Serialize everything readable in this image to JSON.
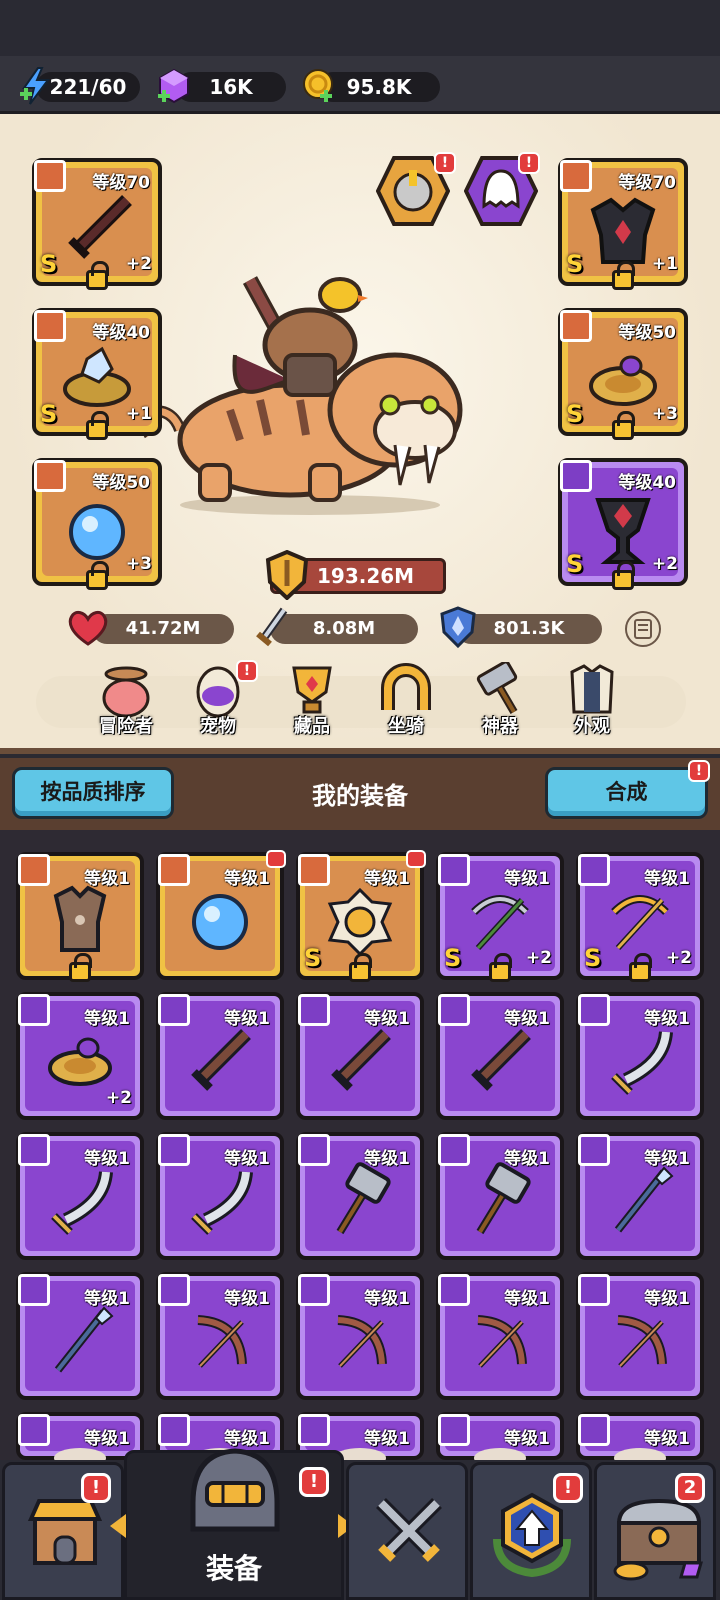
{
  "resources": {
    "energy": "221/60",
    "gems": "16K",
    "gold": "95.8K"
  },
  "equipped": {
    "weapon": {
      "level": "等级70",
      "rank": "S",
      "plus": "+2"
    },
    "armor": {
      "level": "等级70",
      "rank": "S",
      "plus": "+1"
    },
    "ring_left": {
      "level": "等级40",
      "rank": "S",
      "plus": "+1"
    },
    "ring_right": {
      "level": "等级50",
      "rank": "S",
      "plus": "+3"
    },
    "necklace": {
      "level": "等级50",
      "rank": "",
      "plus": "+3"
    },
    "relic": {
      "level": "等级40",
      "rank": "S",
      "plus": "+2"
    }
  },
  "power": "193.26M",
  "stats": {
    "hp": "41.72M",
    "atk": "8.08M",
    "def": "801.3K"
  },
  "char_tabs": [
    "冒险者",
    "宠物",
    "藏品",
    "坐骑",
    "神器",
    "外观"
  ],
  "equipment_header": {
    "sort_button": "按品质排序",
    "title": "我的装备",
    "merge_button": "合成"
  },
  "inventory": [
    {
      "level": "等级1",
      "rarity": "gold",
      "item": "armor",
      "rank": "",
      "plus": "",
      "lock": true,
      "new": false
    },
    {
      "level": "等级1",
      "rarity": "gold",
      "item": "orb",
      "rank": "",
      "plus": "",
      "lock": false,
      "new": true
    },
    {
      "level": "等级1",
      "rarity": "gold",
      "item": "amulet",
      "rank": "S",
      "plus": "",
      "lock": true,
      "new": true
    },
    {
      "level": "等级1",
      "rarity": "purple",
      "item": "crossbow",
      "rank": "S",
      "plus": "+2",
      "lock": true,
      "new": false
    },
    {
      "level": "等级1",
      "rarity": "purple",
      "item": "crossbow-gold",
      "rank": "S",
      "plus": "+2",
      "lock": true,
      "new": false
    },
    {
      "level": "等级1",
      "rarity": "purple",
      "item": "ring",
      "rank": "",
      "plus": "+2",
      "lock": false,
      "new": false
    },
    {
      "level": "等级1",
      "rarity": "purple",
      "item": "sword",
      "rank": "",
      "plus": "",
      "lock": false,
      "new": false
    },
    {
      "level": "等级1",
      "rarity": "purple",
      "item": "sword",
      "rank": "",
      "plus": "",
      "lock": false,
      "new": false
    },
    {
      "level": "等级1",
      "rarity": "purple",
      "item": "sword",
      "rank": "",
      "plus": "",
      "lock": false,
      "new": false
    },
    {
      "level": "等级1",
      "rarity": "purple",
      "item": "scimitar",
      "rank": "",
      "plus": "",
      "lock": false,
      "new": false
    },
    {
      "level": "等级1",
      "rarity": "purple",
      "item": "scimitar",
      "rank": "",
      "plus": "",
      "lock": false,
      "new": false
    },
    {
      "level": "等级1",
      "rarity": "purple",
      "item": "scimitar",
      "rank": "",
      "plus": "",
      "lock": false,
      "new": false
    },
    {
      "level": "等级1",
      "rarity": "purple",
      "item": "hammer",
      "rank": "",
      "plus": "",
      "lock": false,
      "new": false
    },
    {
      "level": "等级1",
      "rarity": "purple",
      "item": "hammer",
      "rank": "",
      "plus": "",
      "lock": false,
      "new": false
    },
    {
      "level": "等级1",
      "rarity": "purple",
      "item": "spear",
      "rank": "",
      "plus": "",
      "lock": false,
      "new": false
    },
    {
      "level": "等级1",
      "rarity": "purple",
      "item": "spear",
      "rank": "",
      "plus": "",
      "lock": false,
      "new": false
    },
    {
      "level": "等级1",
      "rarity": "purple",
      "item": "bow",
      "rank": "",
      "plus": "",
      "lock": false,
      "new": false
    },
    {
      "level": "等级1",
      "rarity": "purple",
      "item": "bow",
      "rank": "",
      "plus": "",
      "lock": false,
      "new": false
    },
    {
      "level": "等级1",
      "rarity": "purple",
      "item": "bow",
      "rank": "",
      "plus": "",
      "lock": false,
      "new": false
    },
    {
      "level": "等级1",
      "rarity": "purple",
      "item": "bow",
      "rank": "",
      "plus": "",
      "lock": false,
      "new": false
    },
    {
      "level": "等级1",
      "rarity": "purple",
      "item": "partial",
      "rank": "",
      "plus": "",
      "lock": false,
      "new": false
    },
    {
      "level": "等级1",
      "rarity": "purple",
      "item": "partial",
      "rank": "",
      "plus": "",
      "lock": false,
      "new": false
    },
    {
      "level": "等级1",
      "rarity": "purple",
      "item": "partial",
      "rank": "",
      "plus": "",
      "lock": false,
      "new": false
    },
    {
      "level": "等级1",
      "rarity": "purple",
      "item": "partial",
      "rank": "",
      "plus": "",
      "lock": false,
      "new": false
    },
    {
      "level": "等级1",
      "rarity": "purple",
      "item": "partial",
      "rank": "",
      "plus": "",
      "lock": false,
      "new": false
    }
  ],
  "nav": {
    "active_label": "装备",
    "chest_count": "2"
  },
  "colors": {
    "gold_frame": "#f0c244",
    "purple_frame": "#8a45cf",
    "badge_red": "#e23c3c",
    "button_blue": "#5fc6e6"
  }
}
